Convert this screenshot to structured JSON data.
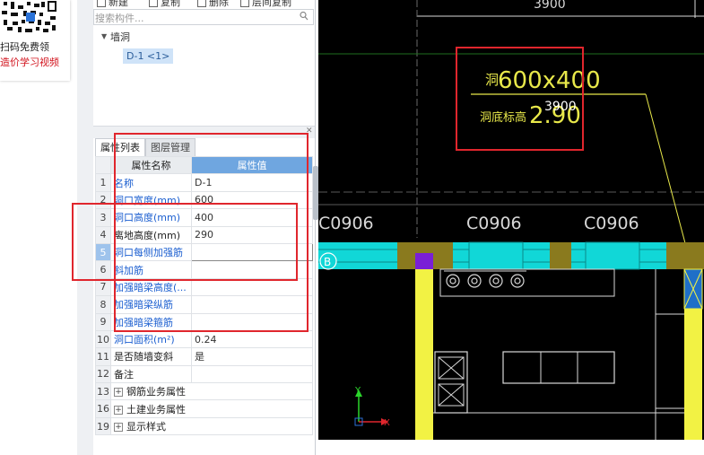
{
  "promo": {
    "line1": "扫码免费领",
    "line2": "造价学习视频",
    "accent": "#d2141e"
  },
  "toolbar": {
    "new": "新建",
    "copy": "复制",
    "delete": "删除",
    "layer_copy": "层间复制"
  },
  "search": {
    "placeholder": "搜索构件..."
  },
  "tree": {
    "root": "墙洞",
    "child": "D-1 <1>"
  },
  "tabs": {
    "properties": "属性列表",
    "layers": "图层管理"
  },
  "grid": {
    "header_name": "属性名称",
    "header_value": "属性值",
    "rows": [
      {
        "idx": "1",
        "name": "名称",
        "value": "D-1"
      },
      {
        "idx": "2",
        "name": "洞口宽度(mm)",
        "value": "600"
      },
      {
        "idx": "3",
        "name": "洞口高度(mm)",
        "value": "400"
      },
      {
        "idx": "4",
        "name": "离地高度(mm)",
        "value": "290"
      },
      {
        "idx": "5",
        "name": "洞口每侧加强筋",
        "value": ""
      },
      {
        "idx": "6",
        "name": "斜加筋",
        "value": ""
      },
      {
        "idx": "7",
        "name": "加强暗梁高度(...",
        "value": ""
      },
      {
        "idx": "8",
        "name": "加强暗梁纵筋",
        "value": ""
      },
      {
        "idx": "9",
        "name": "加强暗梁箍筋",
        "value": ""
      },
      {
        "idx": "10",
        "name": "洞口面积(m²)",
        "value": "0.24"
      },
      {
        "idx": "11",
        "name": "是否随墙变斜",
        "value": "是"
      },
      {
        "idx": "12",
        "name": "备注",
        "value": ""
      },
      {
        "idx": "13",
        "name": "钢筋业务属性",
        "value": ""
      },
      {
        "idx": "16",
        "name": "土建业务属性",
        "value": ""
      },
      {
        "idx": "19",
        "name": "显示样式",
        "value": ""
      }
    ]
  },
  "cad": {
    "top_dim": "3900",
    "hole_label": "洞",
    "hole_size": "600x400",
    "elev_label": "洞底标高",
    "elev_value": "2.90",
    "tooltip": "3900",
    "window_labels": [
      "C0906",
      "C0906",
      "C0906"
    ],
    "axis_marker": "B",
    "axis_x": "X",
    "axis_y": "Y",
    "colors": {
      "background": "#000000",
      "text": "#e8e84a",
      "wall": "#11d7d7",
      "column": "#f2f244",
      "marker": "#7a1fd6"
    }
  }
}
